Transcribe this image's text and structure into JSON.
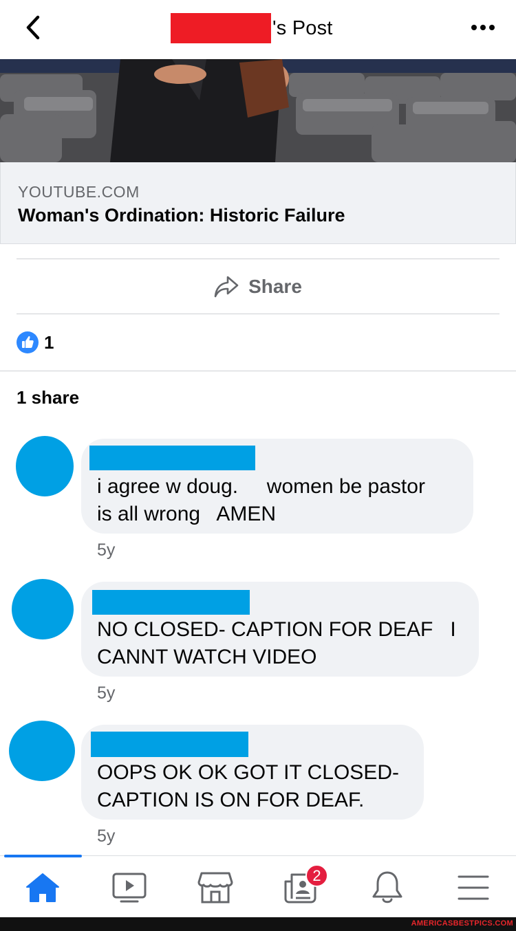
{
  "header": {
    "title_suffix": "'s Post"
  },
  "link_preview": {
    "domain": "YOUTUBE.COM",
    "title": "Woman's Ordination: Historic Failure"
  },
  "actions": {
    "share_label": "Share"
  },
  "reactions": {
    "like_count": "1"
  },
  "shares": {
    "label": "1 share"
  },
  "comments": [
    {
      "text": "i agree w doug.     women be pastor\nis all wrong   AMEN",
      "time": "5y"
    },
    {
      "text": "NO CLOSED- CAPTION FOR DEAF   I\nCANNT WATCH VIDEO",
      "time": "5y"
    },
    {
      "text": "OOPS OK OK GOT IT CLOSED-\nCAPTION IS ON FOR DEAF.",
      "time": "5y"
    }
  ],
  "bottom_nav": {
    "items": [
      "home",
      "watch",
      "marketplace",
      "news",
      "notifications",
      "menu"
    ],
    "news_badge": "2"
  },
  "watermark": "AMERICASBESTPICS.COM",
  "colors": {
    "accent": "#1877f2",
    "redaction_red": "#ee1c25",
    "redaction_blue": "#00a0e4",
    "badge": "#e41e3f"
  }
}
